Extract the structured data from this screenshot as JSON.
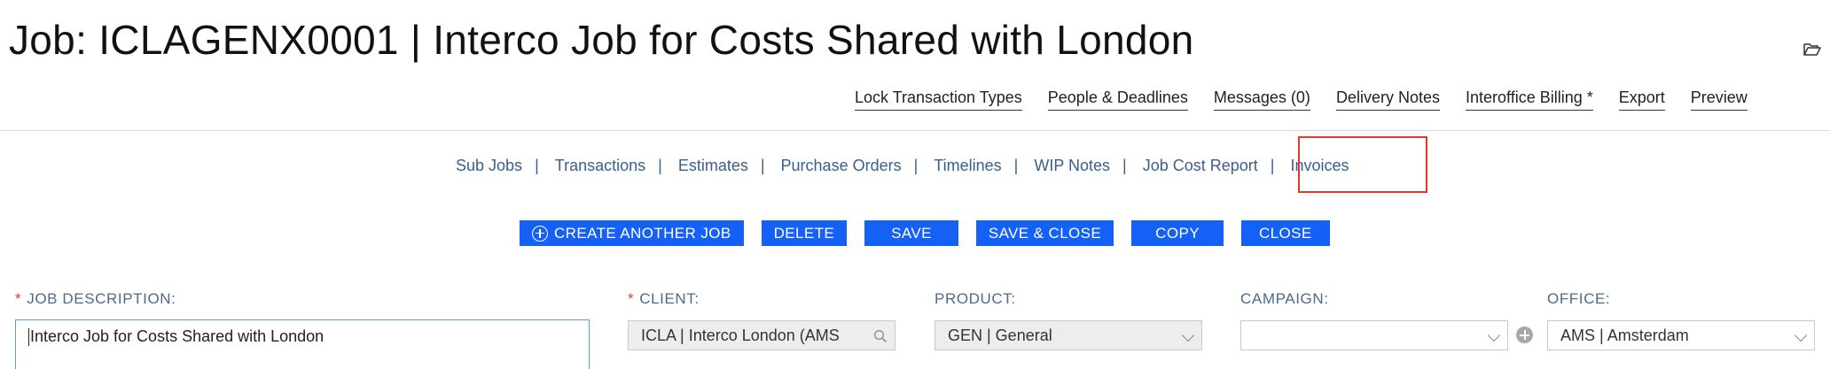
{
  "header": {
    "title": "Job: ICLAGENX0001 | Interco Job for Costs Shared with London",
    "folder_icon": "folder-open-icon"
  },
  "top_links": [
    {
      "label": "Lock Transaction Types"
    },
    {
      "label": "People & Deadlines"
    },
    {
      "label": "Messages (0)"
    },
    {
      "label": "Delivery Notes"
    },
    {
      "label": "Interoffice Billing *"
    },
    {
      "label": "Export"
    },
    {
      "label": "Preview"
    }
  ],
  "sub_tabs": [
    {
      "label": "Sub Jobs"
    },
    {
      "label": "Transactions"
    },
    {
      "label": "Estimates"
    },
    {
      "label": "Purchase Orders"
    },
    {
      "label": "Timelines"
    },
    {
      "label": "WIP Notes"
    },
    {
      "label": "Job Cost Report"
    },
    {
      "label": "Invoices"
    }
  ],
  "sub_tab_separator": "|",
  "buttons": {
    "create": "CREATE ANOTHER JOB",
    "delete": "DELETE",
    "save": "SAVE",
    "save_close": "SAVE & CLOSE",
    "copy": "COPY",
    "close": "CLOSE"
  },
  "form": {
    "required_marker": "*",
    "job_description": {
      "label": "JOB DESCRIPTION:",
      "value": "Interco Job for Costs Shared with London"
    },
    "client": {
      "label": "CLIENT:",
      "value": "ICLA | Interco London (AMS"
    },
    "product": {
      "label": "PRODUCT:",
      "value": "GEN | General"
    },
    "campaign": {
      "label": "CAMPAIGN:",
      "value": ""
    },
    "office": {
      "label": "OFFICE:",
      "value": "AMS | Amsterdam"
    }
  },
  "colors": {
    "primary_button": "#1560f5",
    "highlight_box": "#e03a2f",
    "label_text": "#4a6b8f",
    "link_text": "#3a5f8a"
  }
}
